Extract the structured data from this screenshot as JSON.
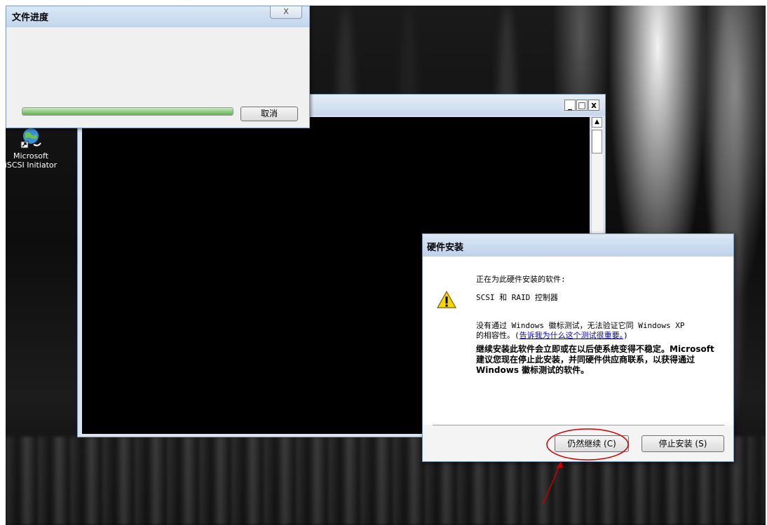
{
  "desktop": {
    "icon_label_line1": "Microsoft",
    "icon_label_line2": "iSCSI Initiator",
    "icon": "iscsi-globe-icon"
  },
  "progress_window": {
    "title": "文件进度",
    "close_label": "X",
    "progress": 1.0,
    "cancel_label": "取消"
  },
  "console_window": {
    "min_label": "_",
    "max_label": "□",
    "close_label": "x",
    "scroll_up_label": "▲"
  },
  "hardware_dialog": {
    "title": "硬件安装",
    "line1": "正在为此硬件安装的软件:",
    "device": "SCSI 和 RAID 控制器",
    "logo_line1": "没有通过 Windows 徽标测试，无法验证它同 Windows XP",
    "logo_line2_prefix": "的相容性。(",
    "logo_link": "告诉我为什么这个测试很重要。",
    "logo_line2_suffix": ")",
    "warning_bold": "继续安装此软件会立即或在以后使系统变得不稳定。Microsoft 建议您现在停止此安装，并同硬件供应商联系，以获得通过 Windows 徽标测试的软件。",
    "continue_label": "仍然继续",
    "continue_hotkey": "(C)",
    "stop_label": "停止安装",
    "stop_hotkey": "(S)"
  },
  "colors": {
    "annotation": "#cc0000",
    "warning_yellow": "#f6d600",
    "title_bar": "#c8d8ea"
  }
}
